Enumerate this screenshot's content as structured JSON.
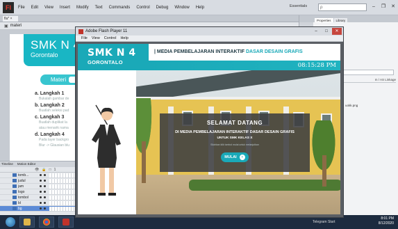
{
  "ide": {
    "logo": "Fl",
    "menu": [
      "File",
      "Edit",
      "View",
      "Insert",
      "Modify",
      "Text",
      "Commands",
      "Control",
      "Debug",
      "Window",
      "Help"
    ],
    "workspace": "Essentials",
    "search_placeholder": "ρ",
    "doc_tab": "fla* ×",
    "scene": "materi",
    "panel_tabs": [
      "Properties",
      "Library"
    ],
    "panel_header": "m / AS Linkage",
    "library_file": "uokk.png",
    "timeline_tabs": [
      "Timeline",
      "Motion Editor"
    ],
    "timeline_frames": "1",
    "layers": [
      {
        "name": "tomb..."
      },
      {
        "name": "judul"
      },
      {
        "name": "jam"
      },
      {
        "name": "logo"
      },
      {
        "name": "tombol"
      },
      {
        "name": "bl"
      },
      {
        "name": "bg",
        "active": true
      }
    ]
  },
  "stage": {
    "title": "SMK N 4",
    "subtitle": "Gorontalo",
    "materi_button": "Materi",
    "steps": [
      {
        "h": "a. Langkah 1",
        "d": [
          "Bukalah gambar de"
        ]
      },
      {
        "h": "b. Langkah 2",
        "d": [
          "Buatlah seleksi pad"
        ]
      },
      {
        "h": "c. Langkah 3",
        "d": [
          "Buatlah duplikat la",
          "atau menarik nama"
        ]
      },
      {
        "h": "d. Langkah 4",
        "d": [
          "Pada layer backgro",
          "Blur -> Glausian blu"
        ]
      }
    ]
  },
  "player": {
    "window_title": "Adobe Flash Player 11",
    "menu": [
      "File",
      "View",
      "Control",
      "Help"
    ],
    "header": {
      "logo_line1": "SMK N 4",
      "logo_line2": "GORONTALO",
      "title_main": "| MEDIA PEMBELAJARAN INTERAKTIF ",
      "title_highlight": "DASAR DESAIN GRAFIS",
      "clock": "08:15:28 PM"
    },
    "welcome": {
      "title": "SELAMAT DATANG",
      "line1": "DI MEDIA PEMBELAJARAN INTERAKTIF DASAR DESAIN GRAFIS",
      "line2": "UNTUK SMK KELAS X",
      "note": "Silahkan klik tombol mulai untuk melanjutkan",
      "button": "MULAI"
    }
  },
  "taskbar": {
    "notice": "Telegram Start",
    "time": "8:01 PM",
    "date": "8/12/2020"
  },
  "colors": {
    "teal": "#1aa9b8",
    "wall": "#e6c353"
  }
}
